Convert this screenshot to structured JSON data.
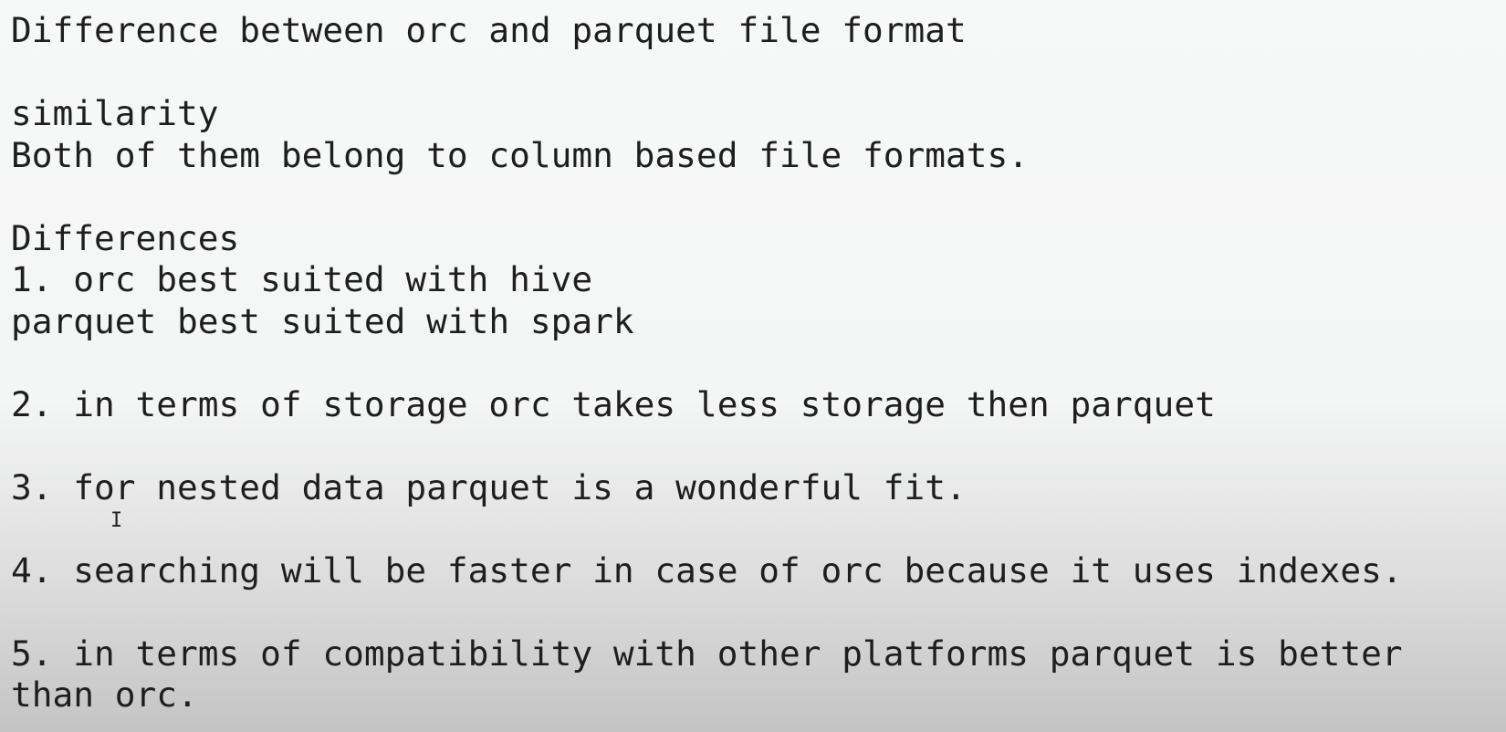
{
  "document": {
    "lines": [
      "Difference between orc and parquet file format",
      "",
      "similarity",
      "Both of them belong to column based file formats.",
      "",
      "Differences",
      "1. orc best suited with hive",
      "parquet best suited with spark",
      "",
      "2. in terms of storage orc takes less storage then parquet",
      "",
      "3. for nested data parquet is a wonderful fit.",
      "",
      "4. searching will be faster in case of orc because it uses indexes.",
      "",
      "5. in terms of compatibility with other platforms parquet is better",
      "than orc."
    ]
  },
  "cursor": {
    "icon": "text-cursor-icon",
    "glyph": "I"
  }
}
